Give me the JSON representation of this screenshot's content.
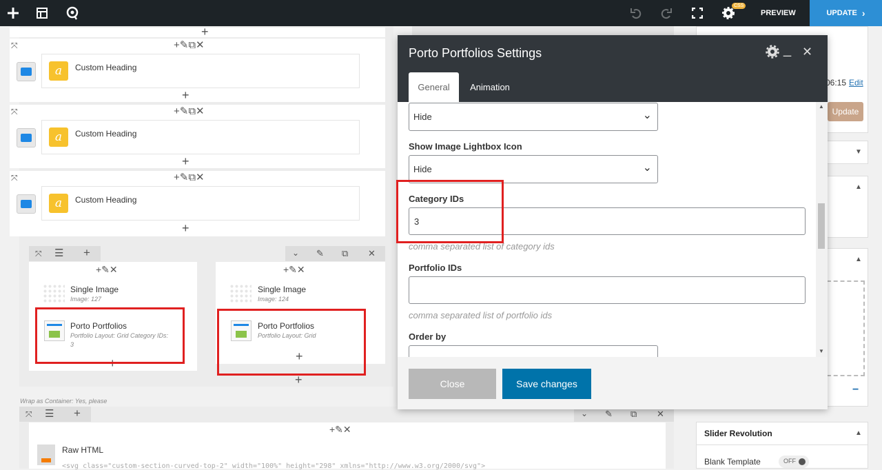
{
  "toolbar": {
    "preview_label": "PREVIEW",
    "update_label": "UPDATE",
    "css_badge": "CSS"
  },
  "editor": {
    "heading_rows": [
      {
        "title": "Custom Heading"
      },
      {
        "title": "Custom Heading"
      },
      {
        "title": "Custom Heading"
      }
    ],
    "left_column": {
      "single_image": {
        "title": "Single Image",
        "sub": "Image: 127"
      },
      "portfolio": {
        "title": "Porto Portfolios",
        "sub": "Portfolio Layout: Grid  Category IDs:",
        "sub2": "3"
      }
    },
    "right_column": {
      "single_image": {
        "title": "Single Image",
        "sub": "Image: 124"
      },
      "portfolio": {
        "title": "Porto Portfolios",
        "sub": "Portfolio Layout: Grid"
      }
    },
    "wrap_note": "Wrap as Container: Yes, please",
    "raw_html": {
      "title": "Raw HTML",
      "code": "<svg class=\"custom-section-curved-top-2\" width=\"100%\" height=\"298\" xmlns=\"http://www.w3.org/2000/svg\">"
    }
  },
  "modal": {
    "title": "Porto Portfolios Settings",
    "tabs": [
      {
        "label": "General"
      },
      {
        "label": "Animation"
      }
    ],
    "fields": {
      "hide_select_1": "Hide",
      "lightbox_label": "Show Image Lightbox Icon",
      "lightbox_value": "Hide",
      "category_label": "Category IDs",
      "category_value": "3",
      "category_hint": "comma separated list of category ids",
      "portfolio_label": "Portfolio IDs",
      "portfolio_value": "",
      "portfolio_hint": "comma separated list of portfolio ids",
      "orderby_label": "Order by"
    },
    "close_label": "Close",
    "save_label": "Save changes"
  },
  "right_panel": {
    "time_text": "06:15",
    "edit_link": "Edit",
    "update_button": "Update",
    "slider_title": "Slider Revolution",
    "blank_template_label": "Blank Template",
    "toggle_label": "OFF"
  },
  "colors": {
    "accent": "#2d8fd5",
    "save_button": "#0073aa",
    "highlight": "#e02020",
    "heading_icon": "#f7c22d"
  }
}
